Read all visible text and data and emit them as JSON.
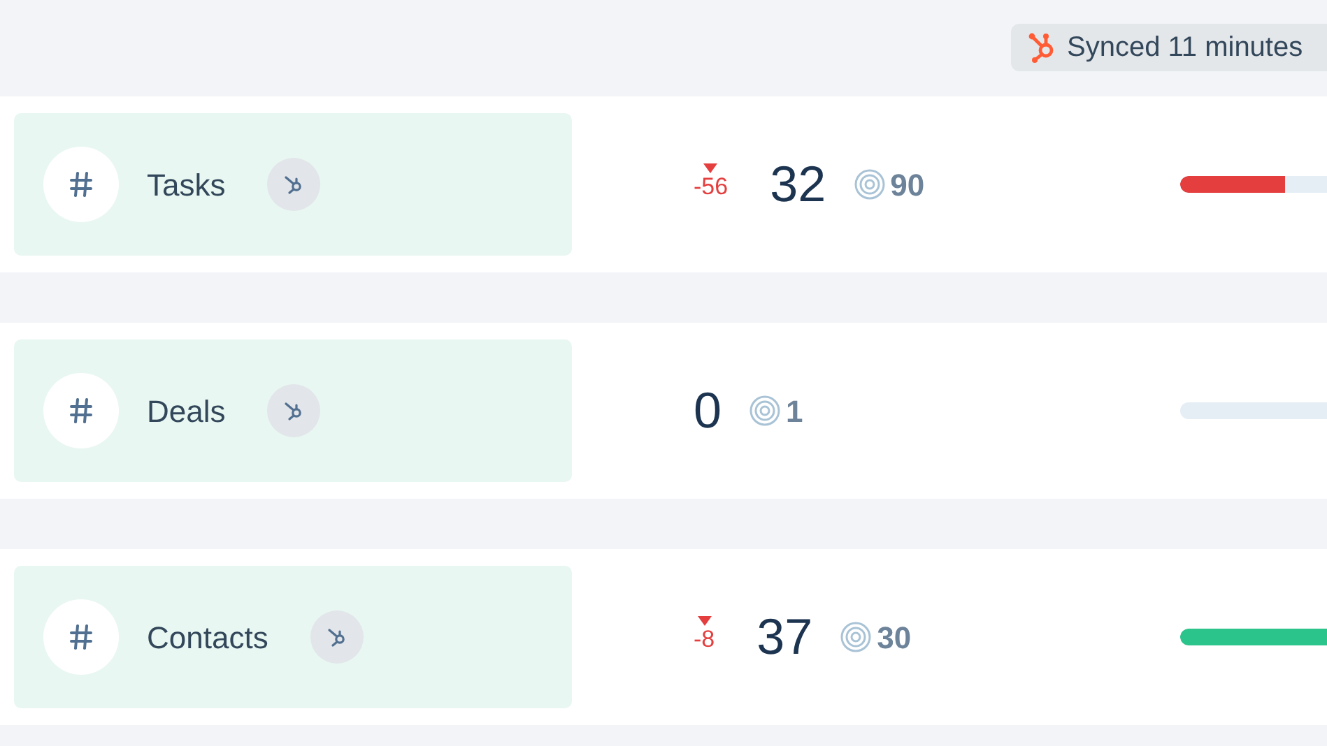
{
  "sync_badge": {
    "text": "Synced 11 minutes"
  },
  "metrics": [
    {
      "label": "Tasks",
      "delta": "-56",
      "decreased": true,
      "value": "32",
      "target": "90",
      "level": 0.71,
      "color": "#e53e3e"
    },
    {
      "label": "Deals",
      "value": "0",
      "target": "1"
    },
    {
      "label": "Contacts",
      "delta": "-8",
      "decreased": true,
      "value": "37",
      "target": "30",
      "level": 1,
      "color": "#2bc48a"
    }
  ]
}
